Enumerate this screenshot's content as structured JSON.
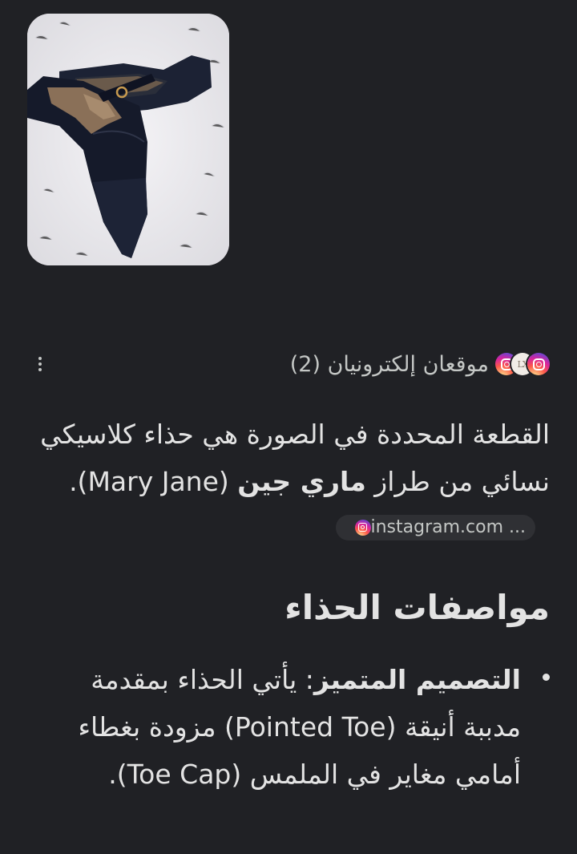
{
  "image": {
    "alt_icon": "shoe-photo"
  },
  "sources": {
    "icons": [
      "instagram-icon",
      "lx-logo-icon",
      "instagram-icon"
    ],
    "label": "موقعان إلكترونيان (2)",
    "more_icon": "more-vert-icon"
  },
  "answer": {
    "text_before": "القطعة المحددة في الصورة هي حذاء كلاسيكي نسائي من طراز ",
    "bold": "ماري جين",
    "text_after": " (Mary Jane).",
    "chip_label": "instagram.com ...",
    "chip_icon": "instagram-icon"
  },
  "section": {
    "heading": "مواصفات الحذاء"
  },
  "bullets": [
    {
      "bold": "التصميم المتميز",
      "text": ": يأتي الحذاء بمقدمة مدببة أنيقة (Pointed Toe) مزودة بغطاء أمامي مغاير في الملمس (Toe Cap)."
    }
  ],
  "colors": {
    "background": "#202125",
    "text": "#e3e3e3",
    "secondary_text": "#c4c7c5",
    "chip_bg": "#2f3034"
  }
}
